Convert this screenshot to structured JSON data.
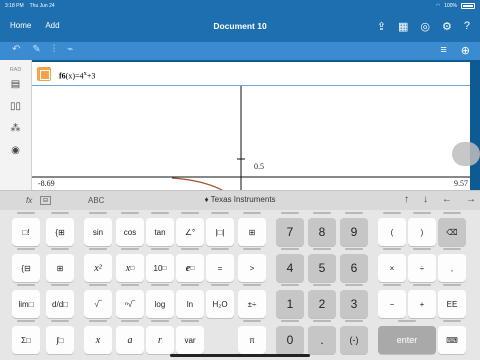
{
  "status": {
    "time": "3:18 PM",
    "date": "Thu Jun 24",
    "battery": "100%"
  },
  "titlebar": {
    "home": "Home",
    "add": "Add",
    "document_title": "Document 10"
  },
  "sidebar": {
    "mode": "RAD"
  },
  "entry": {
    "func_name": "f6",
    "func_arg": "(x)",
    "func_expr": "=4",
    "func_exp": "x",
    "func_tail": "+3"
  },
  "plot": {
    "x_min_label": "-8.69",
    "x_max_label": "9.57",
    "y_tick_label": "0.5"
  },
  "keyboard_toolbar": {
    "fx": "fx",
    "abc": "ABC",
    "brand": "Texas Instruments"
  },
  "keys": {
    "sin": "sin",
    "cos": "cos",
    "tan": "tan",
    "n7": "7",
    "n8": "8",
    "n9": "9",
    "n4": "4",
    "n5": "5",
    "n6": "6",
    "n1": "1",
    "n2": "2",
    "n3": "3",
    "n0": "0",
    "dot": ".",
    "neg": "(-)",
    "lparen": "(",
    "rparen": ")",
    "times": "×",
    "divide": "÷",
    "comma": ",",
    "minus": "−",
    "plus": "+",
    "ee": "EE",
    "enter": "enter",
    "eq": "=",
    "gt": ">",
    "log": "log",
    "ln": "ln",
    "h2o": "H₂O",
    "x": "x",
    "a": "a",
    "r": "r",
    "var": "var",
    "pi": "π",
    "ten_pow": "10",
    "e_pow": "e",
    "x_sq": "x²",
    "x_pow": "x"
  },
  "colors": {
    "header": "#1d6fb0",
    "toolbar": "#3a8bd0",
    "curve": "#a0522d",
    "checkbox": "#f5a24a"
  }
}
